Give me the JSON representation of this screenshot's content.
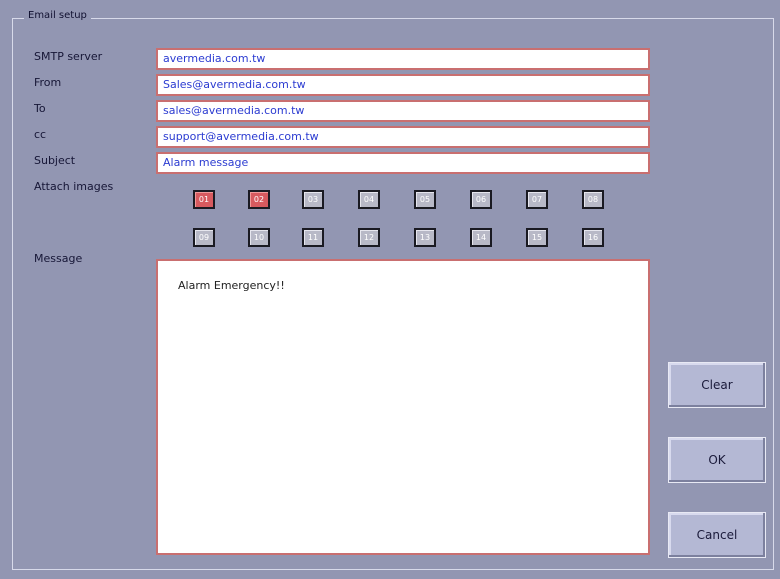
{
  "group_title": "Email setup",
  "fields": [
    {
      "label": "SMTP server",
      "value": "avermedia.com.tw"
    },
    {
      "label": "From",
      "value": "Sales@avermedia.com.tw"
    },
    {
      "label": "To",
      "value": "sales@avermedia.com.tw"
    },
    {
      "label": "cc",
      "value": "support@avermedia.com.tw"
    },
    {
      "label": "Subject",
      "value": "Alarm message"
    }
  ],
  "attach_label": "Attach images",
  "images": [
    {
      "label": "01",
      "selected": true
    },
    {
      "label": "02",
      "selected": true
    },
    {
      "label": "03",
      "selected": false
    },
    {
      "label": "04",
      "selected": false
    },
    {
      "label": "05",
      "selected": false
    },
    {
      "label": "06",
      "selected": false
    },
    {
      "label": "07",
      "selected": false
    },
    {
      "label": "08",
      "selected": false
    },
    {
      "label": "09",
      "selected": false
    },
    {
      "label": "10",
      "selected": false
    },
    {
      "label": "11",
      "selected": false
    },
    {
      "label": "12",
      "selected": false
    },
    {
      "label": "13",
      "selected": false
    },
    {
      "label": "14",
      "selected": false
    },
    {
      "label": "15",
      "selected": false
    },
    {
      "label": "16",
      "selected": false
    }
  ],
  "message_label": "Message",
  "message_text": "Alarm Emergency!!",
  "buttons": {
    "clear": "Clear",
    "ok": "OK",
    "cancel": "Cancel"
  },
  "colors": {
    "background": "#9296b2",
    "field_border": "#c96f70",
    "field_text": "#2b3bd1",
    "selected_image": "#d75a5f"
  }
}
